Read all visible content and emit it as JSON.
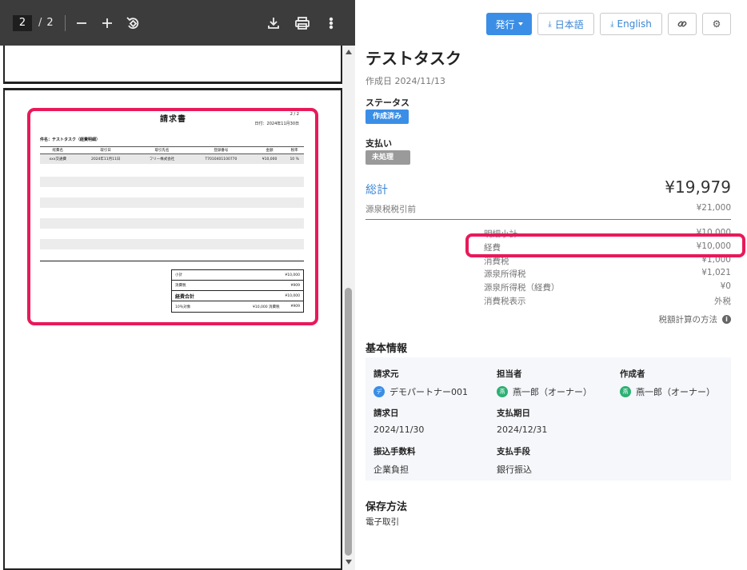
{
  "viewer": {
    "current_page": "2",
    "separator": "/",
    "total_pages": "2",
    "document": {
      "title": "請求書",
      "page": "2 / 2",
      "date": "日付：2024年11月30日",
      "subject": "件名：テストタスク（経費明細）",
      "columns": [
        "経費名",
        "取引日",
        "取引先名",
        "登録番号",
        "金額",
        "税率"
      ],
      "row": [
        "xxx交通費",
        "2024年11月11日",
        "フリー株式会社",
        "T7010401100770",
        "¥10,000",
        "10 %"
      ],
      "summary": {
        "subtotal_label": "小計",
        "subtotal_value": "¥10,000",
        "tax_label": "消費税",
        "tax_value": "¥909",
        "total_label": "経費合計",
        "total_value": "¥10,000",
        "rate_label": "10％対象",
        "rate_mid": "¥10,000 消費税",
        "rate_value": "¥909"
      }
    }
  },
  "panel": {
    "buttons": {
      "issue": "発行",
      "japanese": "日本語",
      "english": "English",
      "link_icon": "link-icon",
      "settings_icon": "gear-icon"
    },
    "title": "テストタスク",
    "created": "作成日 2024/11/13",
    "status_label": "ステータス",
    "status_value": "作成済み",
    "payment_label": "支払い",
    "payment_value": "未処理",
    "total_label": "総計",
    "total_value": "¥19,979",
    "pre_withholding_label": "源泉税税引前",
    "pre_withholding_value": "¥21,000",
    "breakdown": [
      {
        "label": "明細小計",
        "value": "¥10,000"
      },
      {
        "label": "経費",
        "value": "¥10,000"
      },
      {
        "label": "消費税",
        "value": "¥1,000"
      },
      {
        "label": "源泉所得税",
        "value": "¥1,021"
      },
      {
        "label": "源泉所得税（経費）",
        "value": "¥0"
      },
      {
        "label": "消費税表示",
        "value": "外税"
      }
    ],
    "tax_calc_note": "税額計算の方法",
    "basic_title": "基本情報",
    "basic": {
      "issuer_label": "請求元",
      "issuer_value": "デモパートナー001",
      "issuer_avatar": "デ",
      "owner_label": "担当者",
      "owner_value": "燕一郎（オーナー）",
      "owner_avatar": "燕",
      "creator_label": "作成者",
      "creator_value": "燕一郎（オーナー）",
      "creator_avatar": "燕",
      "invoice_date_label": "請求日",
      "invoice_date_value": "2024/11/30",
      "due_date_label": "支払期日",
      "due_date_value": "2024/12/31",
      "fee_label": "振込手数料",
      "fee_value": "企業負担",
      "method_label": "支払手段",
      "method_value": "銀行振込"
    },
    "storage_title": "保存方法",
    "storage_value": "電子取引"
  }
}
